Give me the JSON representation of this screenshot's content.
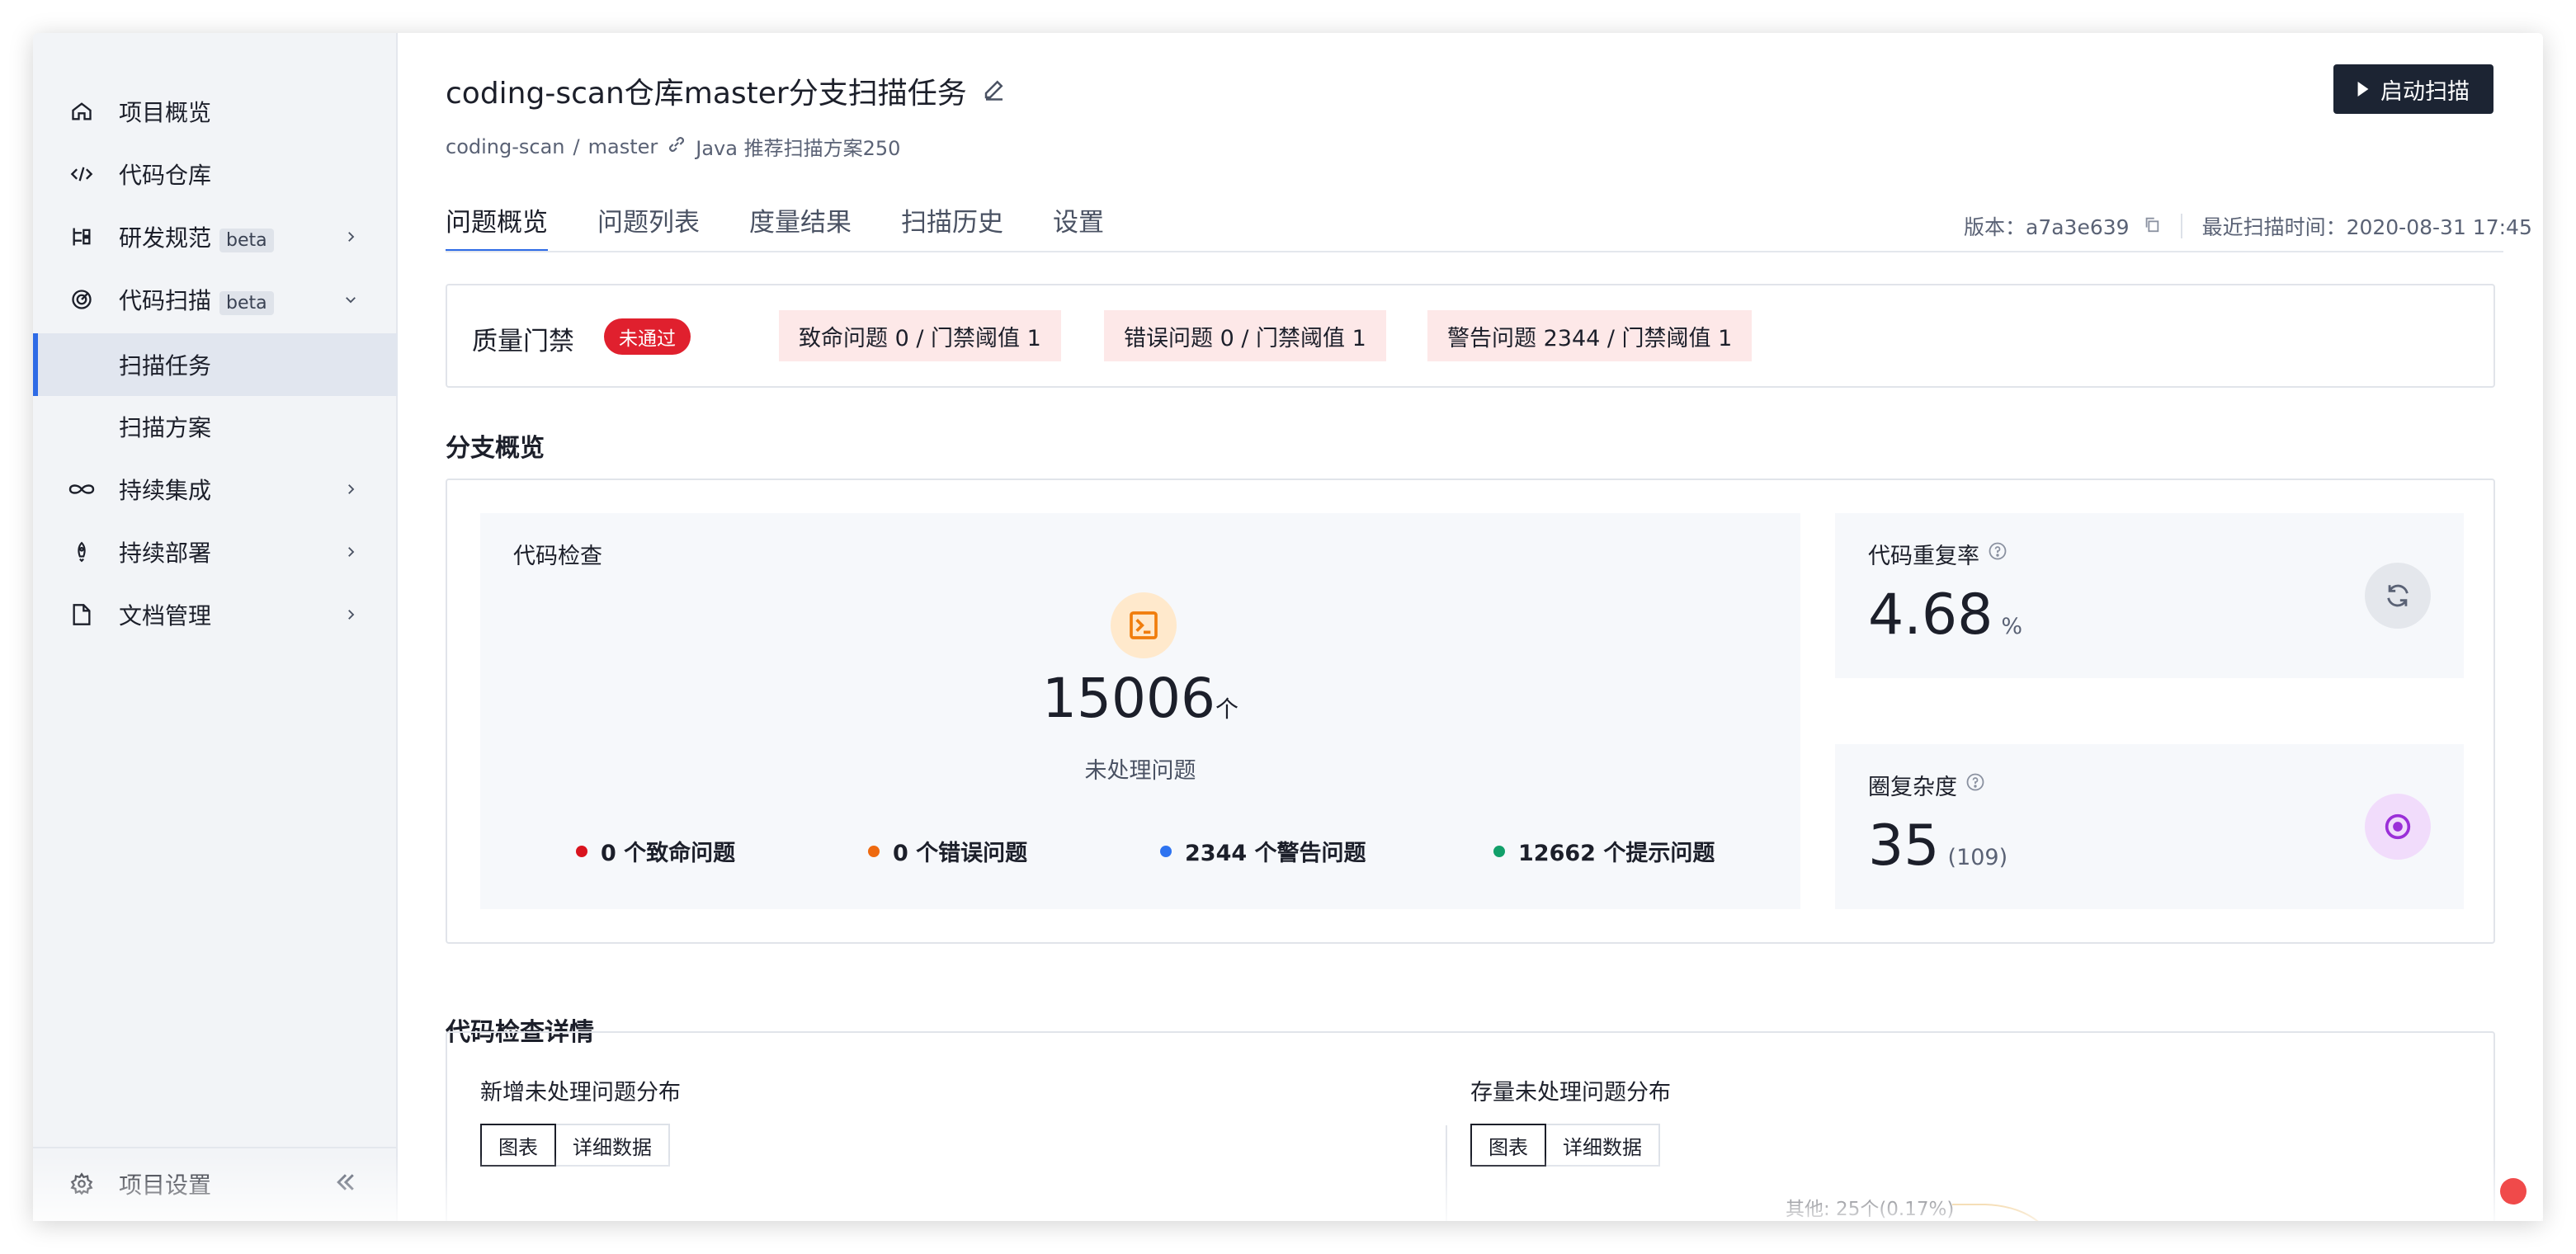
{
  "sidebar": {
    "items": [
      {
        "label": "项目概览",
        "icon": "home-icon"
      },
      {
        "label": "代码仓库",
        "icon": "code-icon"
      },
      {
        "label": "研发规范",
        "icon": "branch-rule-icon",
        "badge": "beta"
      },
      {
        "label": "代码扫描",
        "icon": "radar-icon",
        "badge": "beta"
      },
      {
        "label": "扫描任务"
      },
      {
        "label": "扫描方案"
      },
      {
        "label": "持续集成",
        "icon": "infinity-icon"
      },
      {
        "label": "持续部署",
        "icon": "rocket-icon"
      },
      {
        "label": "文档管理",
        "icon": "document-icon"
      }
    ],
    "footer": {
      "label": "项目设置",
      "icon": "gear-icon"
    }
  },
  "header": {
    "title": "coding-scan仓库master分支扫描任务",
    "breadcrumb": {
      "repo": "coding-scan",
      "sep": "/",
      "branch": "master",
      "scheme": "Java 推荐扫描方案250"
    },
    "start_button": "启动扫描"
  },
  "tabs": [
    "问题概览",
    "问题列表",
    "度量结果",
    "扫描历史",
    "设置"
  ],
  "meta": {
    "version": "版本：a7a3e639",
    "last_scan": "最近扫描时间：2020-08-31 17:45"
  },
  "gate": {
    "title": "质量门禁",
    "status": "未通过",
    "chips": [
      "致命问题 0 / 门禁阈值 1",
      "错误问题 0 / 门禁阈值 1",
      "警告问题 2344 / 门禁阈值 1"
    ]
  },
  "branch_overview": {
    "title": "分支概览",
    "inspection": {
      "title": "代码检查",
      "count": "15006",
      "unit": "个",
      "subtitle": "未处理问题",
      "severities": [
        {
          "label": "0 个致命问题",
          "color": "#d9141e"
        },
        {
          "label": "0 个错误问题",
          "color": "#ee6a10"
        },
        {
          "label": "2344 个警告问题",
          "color": "#2e73f0"
        },
        {
          "label": "12662 个提示问题",
          "color": "#12a06a"
        }
      ]
    },
    "duplication": {
      "title": "代码重复率",
      "value": "4.68",
      "unit": "%"
    },
    "complexity": {
      "title": "圈复杂度",
      "value": "35",
      "sub": "(109)"
    }
  },
  "details": {
    "title": "代码检查详情",
    "new_dist": {
      "title": "新增未处理问题分布",
      "btn_chart": "图表",
      "btn_data": "详细数据"
    },
    "stock_dist": {
      "title": "存量未处理问题分布",
      "btn_chart": "图表",
      "btn_data": "详细数据",
      "other_label": "其他: 25个(0.17%)"
    }
  }
}
